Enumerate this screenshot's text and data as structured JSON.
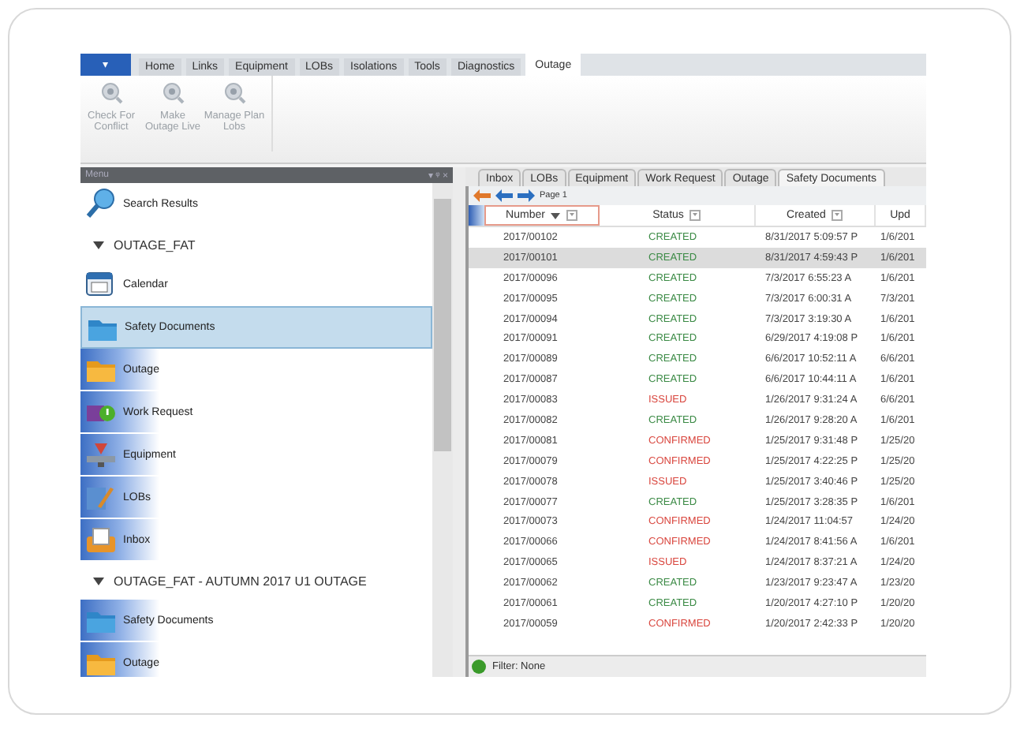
{
  "ribbon": {
    "app_button": "▾",
    "tabs": [
      {
        "label": "Home",
        "selected": false
      },
      {
        "label": "Links",
        "selected": false
      },
      {
        "label": "Equipment",
        "selected": false
      },
      {
        "label": "LOBs",
        "selected": false
      },
      {
        "label": "Isolations",
        "selected": false
      },
      {
        "label": "Tools",
        "selected": false
      },
      {
        "label": "Diagnostics",
        "selected": false
      },
      {
        "label": "Outage",
        "selected": true
      }
    ],
    "buttons": [
      {
        "label": "Check For Conflict",
        "disabled": true
      },
      {
        "label": "Make Outage Live",
        "disabled": true
      },
      {
        "label": "Manage Plan Lobs",
        "disabled": true
      }
    ]
  },
  "menu_panel": {
    "title": "Menu",
    "pin": "▾ ᵠ ×",
    "items": [
      {
        "kind": "link",
        "label": "Search Results",
        "selected": false
      },
      {
        "kind": "group",
        "label": "OUTAGE_FAT",
        "expanded": true,
        "children": [
          {
            "label": "Calendar",
            "selected": false
          },
          {
            "label": "Safety Documents",
            "selected": true
          },
          {
            "label": "Outage",
            "selected": false
          },
          {
            "label": "Work Request",
            "selected": false
          },
          {
            "label": "Equipment",
            "selected": false
          },
          {
            "label": "LOBs",
            "selected": false
          },
          {
            "label": "Inbox",
            "selected": false
          }
        ]
      },
      {
        "kind": "group",
        "label": "OUTAGE_FAT - AUTUMN 2017 U1 OUTAGE",
        "expanded": true,
        "children": [
          {
            "label": "Safety Documents",
            "selected": false
          },
          {
            "label": "Outage",
            "selected": false
          }
        ]
      }
    ]
  },
  "document_tabs": [
    {
      "label": "Inbox",
      "selected": false
    },
    {
      "label": "LOBs",
      "selected": false
    },
    {
      "label": "Equipment",
      "selected": false
    },
    {
      "label": "Work Request",
      "selected": false
    },
    {
      "label": "Outage",
      "selected": false
    },
    {
      "label": "Safety Documents",
      "selected": true
    }
  ],
  "pager": {
    "label": "Page 1"
  },
  "table": {
    "columns": [
      "Number",
      "Status",
      "Created",
      "Upd"
    ],
    "rows": [
      {
        "number": "2017/00102",
        "status": "CREATED",
        "color": "#3b8a45",
        "created": "8/31/2017 5:09:57 P",
        "column_4": "1/6/201",
        "selected": false
      },
      {
        "number": "2017/00101",
        "status": "CREATED",
        "color": "#3b8a45",
        "created": "8/31/2017 4:59:43 P",
        "column_4": "1/6/201",
        "selected": true
      },
      {
        "number": "2017/00096",
        "status": "CREATED",
        "color": "#3b8a45",
        "created": "7/3/2017 6:55:23 A",
        "column_4": "1/6/201",
        "selected": false
      },
      {
        "number": "2017/00095",
        "status": "CREATED",
        "color": "#3b8a45",
        "created": "7/3/2017 6:00:31 A",
        "column_4": "7/3/201",
        "selected": false
      },
      {
        "number": "2017/00094",
        "status": "CREATED",
        "color": "#3b8a45",
        "created": "7/3/2017 3:19:30 A",
        "column_4": "1/6/201",
        "selected": false
      },
      {
        "number": "2017/00091",
        "status": "CREATED",
        "color": "#3b8a45",
        "created": "6/29/2017 4:19:08 P",
        "column_4": "1/6/201",
        "selected": false
      },
      {
        "number": "2017/00089",
        "status": "CREATED",
        "color": "#3b8a45",
        "created": "6/6/2017 10:52:11 A",
        "column_4": "6/6/201",
        "selected": false
      },
      {
        "number": "2017/00087",
        "status": "CREATED",
        "color": "#3b8a45",
        "created": "6/6/2017 10:44:11 A",
        "column_4": "1/6/201",
        "selected": false
      },
      {
        "number": "2017/00083",
        "status": "ISSUED",
        "color": "#d9473f",
        "created": "1/26/2017 9:31:24 A",
        "column_4": "6/6/201",
        "selected": false
      },
      {
        "number": "2017/00082",
        "status": "CREATED",
        "color": "#3b8a45",
        "created": "1/26/2017 9:28:20 A",
        "column_4": "1/6/201",
        "selected": false
      },
      {
        "number": "2017/00081",
        "status": "CONFIRMED",
        "color": "#d9473f",
        "created": "1/25/2017 9:31:48 P",
        "column_4": "1/25/20",
        "selected": false
      },
      {
        "number": "2017/00079",
        "status": "CONFIRMED",
        "color": "#d9473f",
        "created": "1/25/2017 4:22:25 P",
        "column_4": "1/25/20",
        "selected": false
      },
      {
        "number": "2017/00078",
        "status": "ISSUED",
        "color": "#d9473f",
        "created": "1/25/2017 3:40:46 P",
        "column_4": "1/25/20",
        "selected": false
      },
      {
        "number": "2017/00077",
        "status": "CREATED",
        "color": "#3b8a45",
        "created": "1/25/2017 3:28:35 P",
        "column_4": "1/6/201",
        "selected": false
      },
      {
        "number": "2017/00073",
        "status": "CONFIRMED",
        "color": "#d9473f",
        "created": "1/24/2017 11:04:57",
        "column_4": "1/24/20",
        "selected": false
      },
      {
        "number": "2017/00066",
        "status": "CONFIRMED",
        "color": "#d9473f",
        "created": "1/24/2017 8:41:56 A",
        "column_4": "1/6/201",
        "selected": false
      },
      {
        "number": "2017/00065",
        "status": "ISSUED",
        "color": "#d9473f",
        "created": "1/24/2017 8:37:21 A",
        "column_4": "1/24/20",
        "selected": false
      },
      {
        "number": "2017/00062",
        "status": "CREATED",
        "color": "#3b8a45",
        "created": "1/23/2017 9:23:47 A",
        "column_4": "1/23/20",
        "selected": false
      },
      {
        "number": "2017/00061",
        "status": "CREATED",
        "color": "#3b8a45",
        "created": "1/20/2017 4:27:10 P",
        "column_4": "1/20/20",
        "selected": false
      },
      {
        "number": "2017/00059",
        "status": "CONFIRMED",
        "color": "#d9473f",
        "created": "1/20/2017 2:42:33 P",
        "column_4": "1/20/20",
        "selected": false
      }
    ]
  },
  "status_bar": {
    "filter": "Filter: None"
  }
}
